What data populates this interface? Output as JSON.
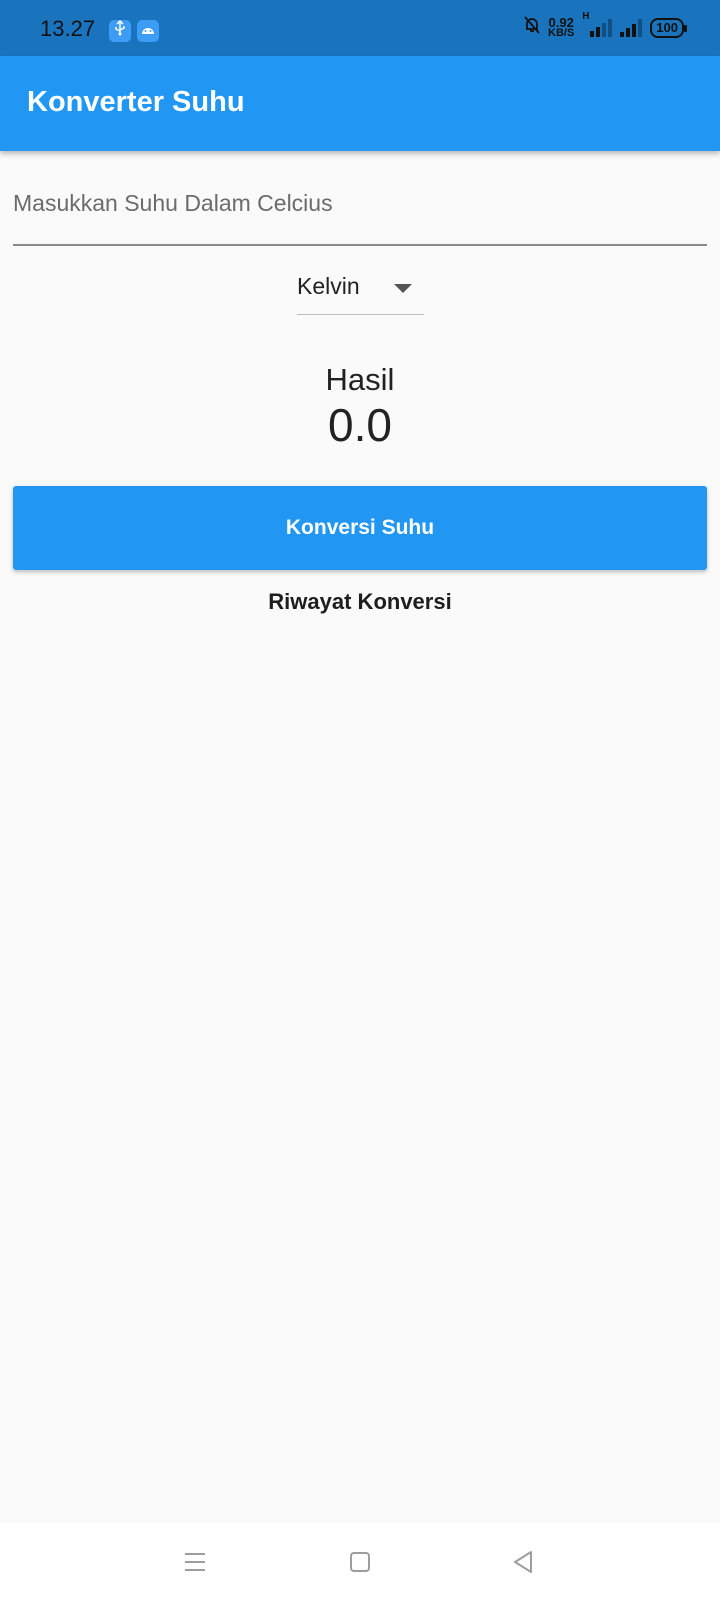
{
  "status_bar": {
    "time": "13.27",
    "notif_icons": [
      "usb-icon",
      "android-icon"
    ],
    "net_speed_value": "0.92",
    "net_speed_unit": "KB/S",
    "network_type": "H",
    "battery": "100"
  },
  "app_bar": {
    "title": "Konverter Suhu",
    "color": "#2196f3"
  },
  "input": {
    "placeholder": "Masukkan Suhu Dalam Celcius",
    "value": ""
  },
  "dropdown": {
    "selected": "Kelvin"
  },
  "result": {
    "label": "Hasil",
    "value": "0.0"
  },
  "convert_button": {
    "label": "Konversi Suhu"
  },
  "history": {
    "title": "Riwayat Konversi",
    "items": []
  },
  "nav_bar": {
    "icons": [
      "menu-icon",
      "home-icon",
      "back-icon"
    ]
  }
}
